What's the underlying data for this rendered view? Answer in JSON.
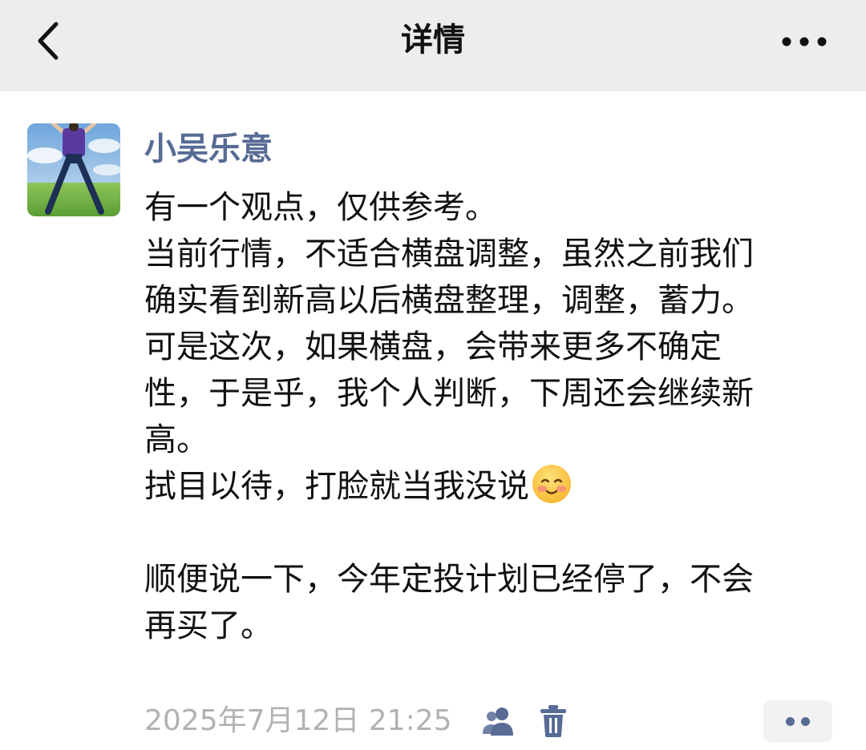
{
  "header": {
    "title": "详情",
    "back_icon": "chevron-left-icon",
    "more_icon": "more-dots-icon"
  },
  "post": {
    "author": "小吴乐意",
    "lines": [
      "有一个观点，仅供参考。",
      "当前行情，不适合横盘调整，虽然之前我们",
      "确实看到新高以后横盘整理，调整，蓄力。",
      "可是这次，如果横盘，会带来更多不确定",
      "性，于是乎，我个人判断，下周还会继续新",
      "高。",
      "拭目以待，打脸就当我没说",
      "",
      "顺便说一下，今年定投计划已经停了，不会",
      "再买了。"
    ],
    "emoji": "blushing-smile-emoji",
    "timestamp": "2025年7月12日 21:25",
    "visibility_icon": "people-icon",
    "delete_icon": "trash-icon",
    "action_icon": "two-dots-icon"
  },
  "colors": {
    "nav_background": "#ededed",
    "author_link": "#576b95",
    "timestamp": "#b2b2b2",
    "body_text": "#111111"
  }
}
